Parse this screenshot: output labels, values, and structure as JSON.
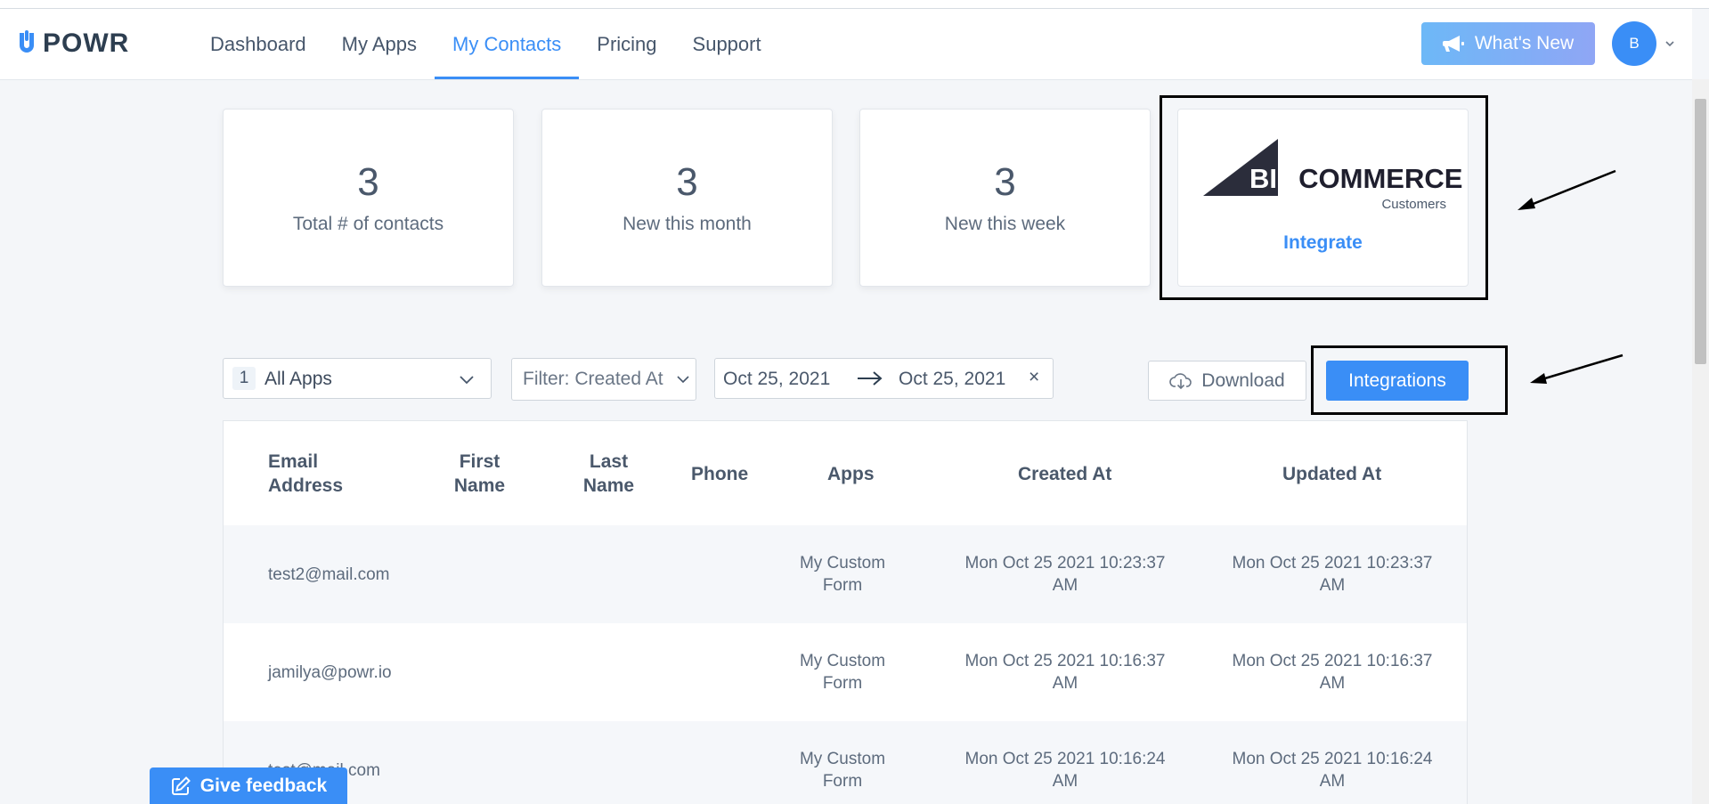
{
  "app": {
    "name": "POWR"
  },
  "nav": {
    "items": [
      {
        "label": "Dashboard"
      },
      {
        "label": "My Apps"
      },
      {
        "label": "My Contacts",
        "active": true
      },
      {
        "label": "Pricing"
      },
      {
        "label": "Support"
      }
    ]
  },
  "header": {
    "whats_new": "What's New",
    "avatar_initial": "B"
  },
  "stats": [
    {
      "value": "3",
      "label": "Total # of contacts"
    },
    {
      "value": "3",
      "label": "New this month"
    },
    {
      "value": "3",
      "label": "New this week"
    }
  ],
  "bigcommerce": {
    "logo_big": "BIG",
    "logo_rest": "COMMERCE",
    "subtitle": "Customers",
    "action": "Integrate"
  },
  "filters": {
    "apps_count": "1",
    "apps_label": "All Apps",
    "filter_label": "Filter: Created At",
    "date_start": "Oct 25, 2021",
    "date_end": "Oct 25, 2021",
    "clear": "×"
  },
  "toolbar": {
    "download": "Download",
    "integrations": "Integrations"
  },
  "table": {
    "columns": [
      "Email Address",
      "First Name",
      "Last Name",
      "Phone",
      "Apps",
      "Created At",
      "Updated At"
    ],
    "rows": [
      {
        "email": "test2@mail.com",
        "first": "",
        "last": "",
        "phone": "",
        "apps": "My Custom Form",
        "created": "Mon Oct 25 2021 10:23:37 AM",
        "updated": "Mon Oct 25 2021 10:23:37 AM"
      },
      {
        "email": "jamilya@powr.io",
        "first": "",
        "last": "",
        "phone": "",
        "apps": "My Custom Form",
        "created": "Mon Oct 25 2021 10:16:37 AM",
        "updated": "Mon Oct 25 2021 10:16:37 AM"
      },
      {
        "email": "test@mail.com",
        "first": "",
        "last": "",
        "phone": "",
        "apps": "My Custom Form",
        "created": "Mon Oct 25 2021 10:16:24 AM",
        "updated": "Mon Oct 25 2021 10:16:24 AM"
      }
    ]
  },
  "feedback": {
    "label": "Give feedback"
  },
  "colors": {
    "accent": "#3a8ef6",
    "text": "#3d4a5c",
    "background": "#f4f6f9"
  }
}
